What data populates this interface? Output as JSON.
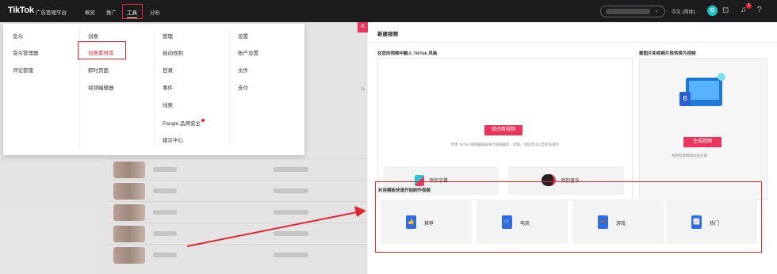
{
  "header": {
    "logo": "TikTok",
    "logo_sub": "广告管理平台",
    "nav": [
      "概览",
      "推广",
      "工具",
      "分析"
    ],
    "active_nav": "工具",
    "language": "中文 (简体)",
    "avatar_letter": "O",
    "notification_count": "1",
    "icons": [
      "case-icon",
      "bell-icon",
      "help-icon"
    ]
  },
  "dropdown": {
    "col1": [
      "受众",
      "受众管理器",
      "评论管理"
    ],
    "col2": [
      "创意",
      "创意素材库",
      "即时页面",
      "视频编辑器"
    ],
    "col3": [
      "管理",
      "自动规则",
      "目录",
      "事件",
      "线索",
      "Pangle 品牌安全",
      "建议中心"
    ],
    "col4": [
      "设置",
      "账户设置",
      "文件",
      "支付"
    ]
  },
  "panel": {
    "title": "新建视频",
    "section1_title": "在您的视频中融入 TikTok 风格",
    "edit_button": "修改新视频",
    "edit_hint": "利用 TikTok 视频编辑器进行视频截剪、调辑、添加音乐以及更多操作",
    "add_caption": "添加字幕",
    "add_music": "添加音乐",
    "section2_title": "截图片和视频片段转换为视频",
    "generate_button": "生成视频",
    "generate_hint": "利用智能网络动态生成",
    "section3_title": "利用模板快速开始制作视频",
    "templates": [
      "推荐",
      "电商",
      "游戏",
      "热门"
    ]
  },
  "colors": {
    "accent": "#e8365c",
    "highlight": "#e0272d",
    "header_bg": "#1c1c1e"
  }
}
